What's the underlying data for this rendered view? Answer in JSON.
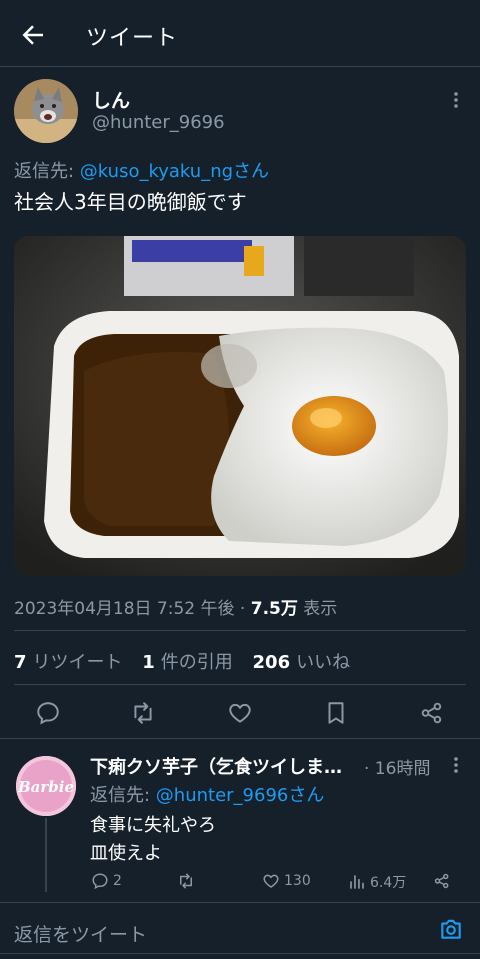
{
  "header": {
    "title": "ツイート"
  },
  "tweet": {
    "display_name": "しん",
    "handle": "@hunter_9696",
    "reply_label": "返信先: ",
    "reply_to": "@kuso_kyaku_ngさん",
    "text": "社会人3年目の晩御飯です",
    "timestamp": "2023年04月18日 7:52 午後 · ",
    "views": "7.5万",
    "views_label": " 表示",
    "retweets": "7",
    "retweets_label": "リツイート",
    "quotes": "1",
    "quotes_label": "件の引用",
    "likes": "206",
    "likes_label": "いいね"
  },
  "reply": {
    "display_name": "下痢クソ芋子（乞食ツイしま…",
    "time": "· 16時間",
    "reply_label": "返信先: ",
    "reply_to": "@hunter_9696さん",
    "line1": "食事に失礼やろ",
    "line2": "皿使えよ",
    "replies": "2",
    "likes": "130",
    "views": "6.4万",
    "avatar_text": "Barbie"
  },
  "composer": {
    "placeholder": "返信をツイート"
  },
  "colors": {
    "background": "#15202b",
    "accent": "#1d9bf0",
    "muted": "#8b98a5",
    "divider": "#38444d"
  }
}
